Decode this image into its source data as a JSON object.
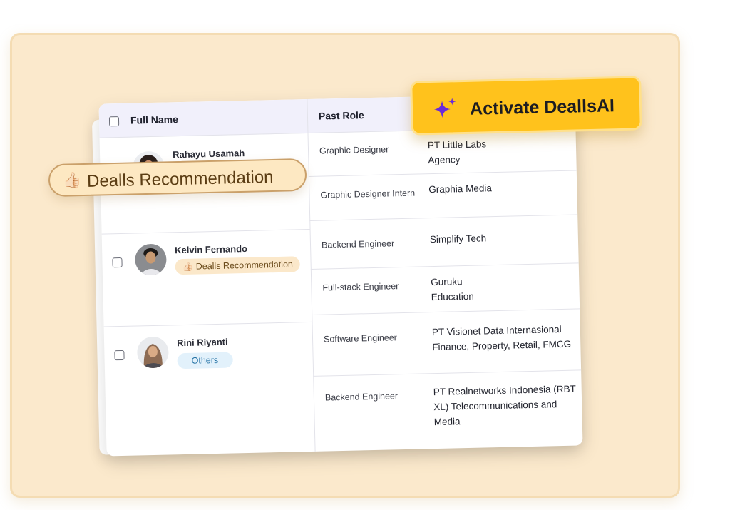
{
  "table": {
    "headers": {
      "full_name": "Full Name",
      "past_role": "Past Role"
    },
    "candidates": [
      {
        "name": "Rahayu Usamah",
        "roles": [
          {
            "role": "Graphic Designer",
            "company": "PT Little Labs Agency"
          },
          {
            "role": "Graphic Designer Intern",
            "company": "Graphia Media"
          }
        ]
      },
      {
        "name": "Kelvin Fernando",
        "tag": "Dealls Recommendation",
        "tag_icon": "👍🏻",
        "roles": [
          {
            "role": "Backend Engineer",
            "company": "Simplify Tech"
          },
          {
            "role": "Full-stack Engineer",
            "company": "Guruku Education"
          }
        ]
      },
      {
        "name": "Rini Riyanti",
        "tag": "Others",
        "roles": [
          {
            "role": "Software Engineer",
            "company": "PT Visionet Data Internasional Finance, Property, Retail, FMCG"
          },
          {
            "role": "Backend Engineer",
            "company": "PT Realnetworks Indonesia (RBT XL) Telecommunications and Media"
          }
        ]
      }
    ]
  },
  "floating": {
    "recommendation_pill": {
      "icon": "👍🏻",
      "label": "Dealls Recommendation"
    },
    "activate_button": {
      "label": "Activate DeallsAI",
      "icon": "sparkle-icon"
    }
  },
  "colors": {
    "backdrop": "#fbe9cc",
    "cta_yellow": "#ffc21c",
    "sparkle_purple": "#6a2bd9",
    "header_bg": "#f1f0fb",
    "recommendation_tag": "#fbe8ca",
    "others_tag": "#e2f1fb"
  }
}
